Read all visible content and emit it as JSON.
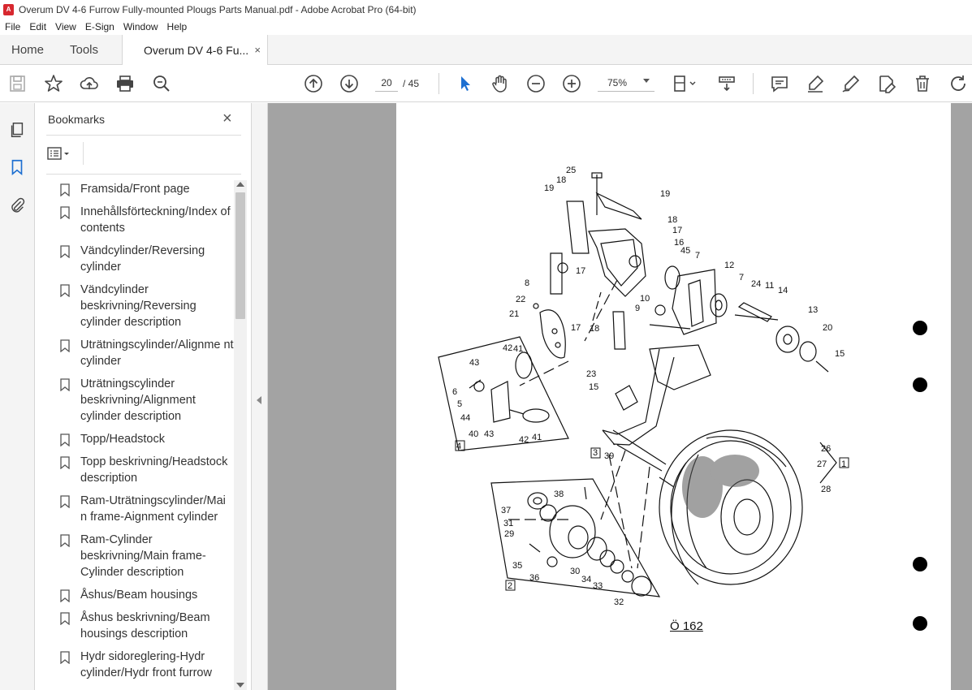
{
  "window": {
    "title": "Overum DV 4-6 Furrow Fully-mounted Plougs Parts Manual.pdf - Adobe Acrobat Pro (64-bit)",
    "app_icon": "pdf-icon"
  },
  "menu": [
    "File",
    "Edit",
    "View",
    "E-Sign",
    "Window",
    "Help"
  ],
  "tabs": {
    "home": "Home",
    "tools": "Tools",
    "document": "Overum DV 4-6 Fu...",
    "close_symbol": "×"
  },
  "toolbar": {
    "page_current": "20",
    "page_total": "/  45",
    "zoom": "75%",
    "icons": [
      "save-icon",
      "star-icon",
      "upload-icon",
      "print-icon",
      "zoom-search-icon",
      "page-up-icon",
      "page-down-icon",
      "select-arrow-icon",
      "hand-icon",
      "zoom-out-icon",
      "zoom-in-icon",
      "page-fit-icon",
      "scroll-mode-icon",
      "comment-icon",
      "highlight-icon",
      "sign-icon",
      "edit-pdf-icon",
      "delete-icon",
      "rotate-icon"
    ]
  },
  "sidebar": {
    "title": "Bookmarks",
    "close_symbol": "×",
    "bookmarks": [
      "Framsida/Front page",
      "Innehållsförteckning/Index of contents",
      "Vändcylinder/Reversing cylinder",
      "Vändcylinder beskrivning/Reversing cylinder description",
      "Uträtningscylinder/Alignme nt cylinder",
      "Uträtningscylinder beskrivning/Alignment cylinder description",
      "Topp/Headstock",
      "Topp beskrivning/Headstock description",
      "Ram-Uträtningscylinder/Mai n frame-Aignment cylinder",
      "Ram-Cylinder beskrivning/Main frame-Cylinder description",
      "Åshus/Beam housings",
      "Åshus beskrivning/Beam housings description",
      "Hydr sidoreglering-Hydr cylinder/Hydr front furrow"
    ]
  },
  "document": {
    "caption": "Ö 162",
    "callouts": [
      "25",
      "18",
      "19",
      "19",
      "18",
      "17",
      "16",
      "45",
      "17",
      "8",
      "7",
      "12",
      "7",
      "24",
      "11",
      "14",
      "22",
      "21",
      "10",
      "9",
      "17",
      "18",
      "13",
      "20",
      "15",
      "43",
      "42",
      "41",
      "6",
      "5",
      "44",
      "40",
      "43",
      "42",
      "41",
      "4",
      "23",
      "15",
      "3",
      "39",
      "26",
      "27",
      "1",
      "28",
      "38",
      "37",
      "31",
      "29",
      "35",
      "36",
      "30",
      "34",
      "33",
      "32",
      "2"
    ]
  }
}
